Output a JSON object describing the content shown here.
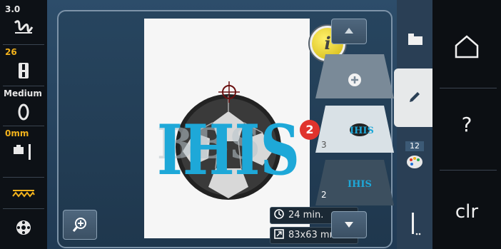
{
  "left_panel": {
    "stitch_length": "3.0",
    "needle_position": "26",
    "thread_tension": "Medium",
    "presser_foot_pressure": "0mm"
  },
  "canvas": {
    "logo_text": "IHIS"
  },
  "info_button": {
    "label": "i"
  },
  "status": {
    "time": "24 min.",
    "size": "83x63 mm"
  },
  "layers": [
    {
      "number": "3",
      "label": "IHIS"
    },
    {
      "number": "2",
      "label": "IHIS"
    }
  ],
  "callout": {
    "number": "2"
  },
  "right_tabs": {
    "colors_count": "12"
  },
  "right_buttons": {
    "help_label": "?",
    "clear_label": "clr"
  },
  "colors": {
    "accent_yellow": "#f2b21c",
    "logo_blue": "#1ea8d8",
    "callout_red": "#e0332c"
  }
}
